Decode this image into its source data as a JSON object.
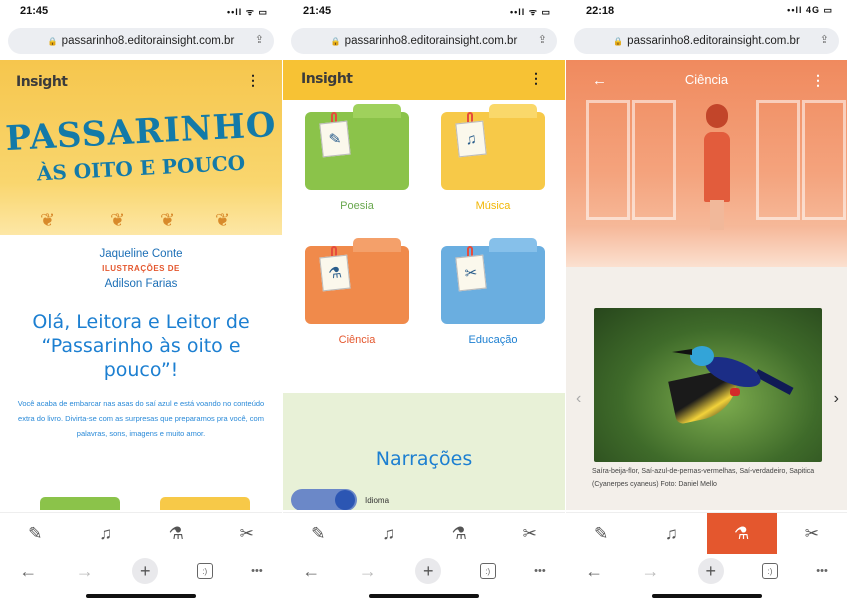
{
  "screens": [
    {
      "time": "21:45",
      "status_icons": "••ll ᯤ ▭",
      "url": "passarinho8.editorainsight.com.br",
      "logo": "Insight",
      "menu": "⋮",
      "book_title": "PASSARINHO",
      "book_subtitle": "ÀS OITO E POUCO",
      "author": "Jaqueline Conte",
      "illustrations_label": "ILUSTRAÇÕES DE",
      "illustrator": "Adilson Farias",
      "greeting": "Olá, Leitora e Leitor de “Passarinho às oito e pouco”!",
      "intro": "Você acaba de embarcar nas asas do saí azul e está voando no conteúdo extra do livro. Divirta-se com as surpresas que preparamos pra você, com palavras, sons, imagens e muito amor."
    },
    {
      "time": "21:45",
      "status_icons": "••ll ᯤ ▭",
      "url": "passarinho8.editorainsight.com.br",
      "logo": "Insight",
      "menu": "⋮",
      "categories": [
        {
          "label": "Poesia",
          "color": "#8bc34a",
          "label_color": "#6aa84f",
          "icon": "✎"
        },
        {
          "label": "Música",
          "color": "#f7c948",
          "label_color": "#f2b705",
          "icon": "♫"
        },
        {
          "label": "Ciência",
          "color": "#f08a4b",
          "label_color": "#e4572e",
          "icon": "⚗"
        },
        {
          "label": "Educação",
          "color": "#6aaee0",
          "label_color": "#1c7fd1",
          "icon": "✂"
        }
      ],
      "section_title": "Narrações",
      "language_label": "Idioma"
    },
    {
      "time": "22:18",
      "status_icons": "••ll 4G ▭",
      "url": "passarinho8.editorainsight.com.br",
      "back": "←",
      "category_title": "Ciência",
      "menu": "⋮",
      "caption": "Saíra-beija-flor, Saí-azul-de-pernas-vermelhas, Saí-verdadeiro, Sapitica (Cyanerpes cyaneus) Foto: Daniel Mello",
      "prev": "‹",
      "next": "›"
    }
  ],
  "tab_icons": [
    "✎",
    "♫",
    "⚗",
    "✂"
  ],
  "browser": {
    "back": "←",
    "forward": "→",
    "new_tab": "+",
    "tabs": ":)",
    "more": "•••"
  },
  "colors": {
    "accent_orange": "#e4572e",
    "header_yellow": "#f7c234",
    "title_blue": "#1c7fd1"
  }
}
